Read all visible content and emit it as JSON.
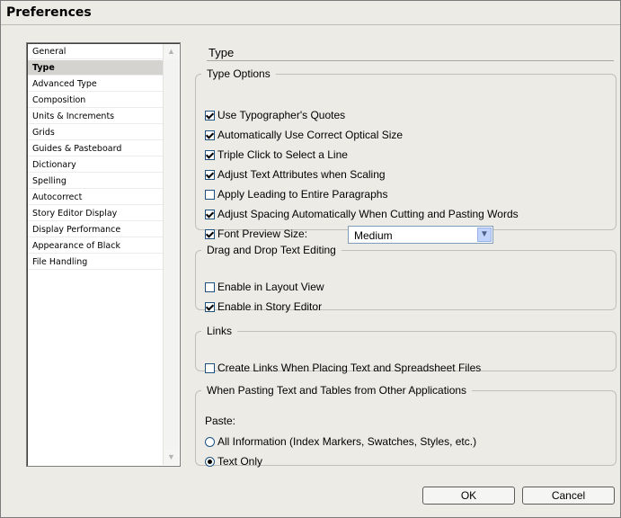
{
  "window": {
    "title": "Preferences"
  },
  "sidebar": {
    "items": [
      {
        "label": "General",
        "selected": false
      },
      {
        "label": "Type",
        "selected": true
      },
      {
        "label": "Advanced Type",
        "selected": false
      },
      {
        "label": "Composition",
        "selected": false
      },
      {
        "label": "Units & Increments",
        "selected": false
      },
      {
        "label": "Grids",
        "selected": false
      },
      {
        "label": "Guides & Pasteboard",
        "selected": false
      },
      {
        "label": "Dictionary",
        "selected": false
      },
      {
        "label": "Spelling",
        "selected": false
      },
      {
        "label": "Autocorrect",
        "selected": false
      },
      {
        "label": "Story Editor Display",
        "selected": false
      },
      {
        "label": "Display Performance",
        "selected": false
      },
      {
        "label": "Appearance of Black",
        "selected": false
      },
      {
        "label": "File Handling",
        "selected": false
      }
    ]
  },
  "panel": {
    "title": "Type",
    "type_options": {
      "legend": "Type Options",
      "options": [
        {
          "label": "Use Typographer's Quotes",
          "checked": true
        },
        {
          "label": "Automatically Use Correct Optical Size",
          "checked": true
        },
        {
          "label": "Triple Click to Select a Line",
          "checked": true
        },
        {
          "label": "Adjust Text Attributes when Scaling",
          "checked": true
        },
        {
          "label": "Apply Leading to Entire Paragraphs",
          "checked": false
        },
        {
          "label": "Adjust Spacing Automatically When Cutting and Pasting Words",
          "checked": true
        },
        {
          "label": "Font Preview Size:",
          "checked": true
        }
      ],
      "font_preview_size": "Medium"
    },
    "drag_drop": {
      "legend": "Drag and Drop Text Editing",
      "options": [
        {
          "label": "Enable in Layout View",
          "checked": false
        },
        {
          "label": "Enable in Story Editor",
          "checked": true
        }
      ]
    },
    "links": {
      "legend": "Links",
      "options": [
        {
          "label": "Create Links When Placing Text and Spreadsheet Files",
          "checked": false
        }
      ]
    },
    "pasting": {
      "legend": "When Pasting Text and Tables from Other Applications",
      "paste_label": "Paste:",
      "options": [
        {
          "label": "All Information (Index Markers, Swatches, Styles, etc.)",
          "selected": false
        },
        {
          "label": "Text Only",
          "selected": true
        }
      ]
    }
  },
  "buttons": {
    "ok": "OK",
    "cancel": "Cancel"
  }
}
